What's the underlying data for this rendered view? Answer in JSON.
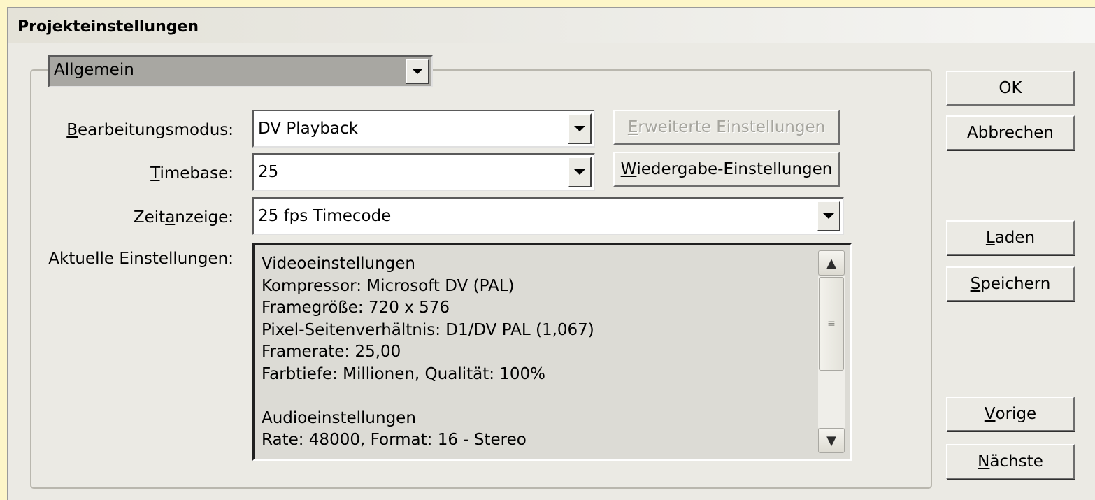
{
  "window": {
    "title": "Projekteinstellungen"
  },
  "category": {
    "value": "Allgemein"
  },
  "fields": {
    "edit_mode": {
      "label_pre": "",
      "label_key": "B",
      "label_post": "earbeitungsmodus:",
      "value": "DV Playback"
    },
    "timebase": {
      "label_pre": "",
      "label_key": "T",
      "label_post": "imebase:",
      "value": "25"
    },
    "time_display": {
      "label_pre": "Zeit",
      "label_key": "a",
      "label_post": "nzeige:",
      "value": "25 fps Timecode"
    },
    "current_settings": {
      "label": "Aktuelle Einstellungen:"
    }
  },
  "buttons": {
    "advanced": {
      "key": "E",
      "rest": "rweiterte Einstellungen",
      "disabled": true
    },
    "playback": {
      "key": "W",
      "rest": "iedergabe-Einstellungen"
    },
    "ok": {
      "label": "OK"
    },
    "cancel": {
      "label": "Abbrechen"
    },
    "load": {
      "key": "L",
      "rest": "aden"
    },
    "save": {
      "key": "S",
      "rest": "peichern"
    },
    "previous": {
      "key": "V",
      "rest": "orige"
    },
    "next": {
      "key": "N",
      "rest": "ächste"
    }
  },
  "settings_text": [
    "Videoeinstellungen",
    "Kompressor: Microsoft DV (PAL)",
    "Framegröße: 720 x 576",
    "Pixel-Seitenverhältnis: D1/DV PAL (1,067)",
    "Framerate: 25,00",
    "Farbtiefe: Millionen, Qualität: 100%",
    "",
    "Audioeinstellungen",
    "Rate: 48000, Format: 16 - Stereo"
  ],
  "icons": {
    "dropdown": "chevron-down-icon",
    "scroll_up": "scroll-up-icon",
    "scroll_down": "scroll-down-icon"
  }
}
